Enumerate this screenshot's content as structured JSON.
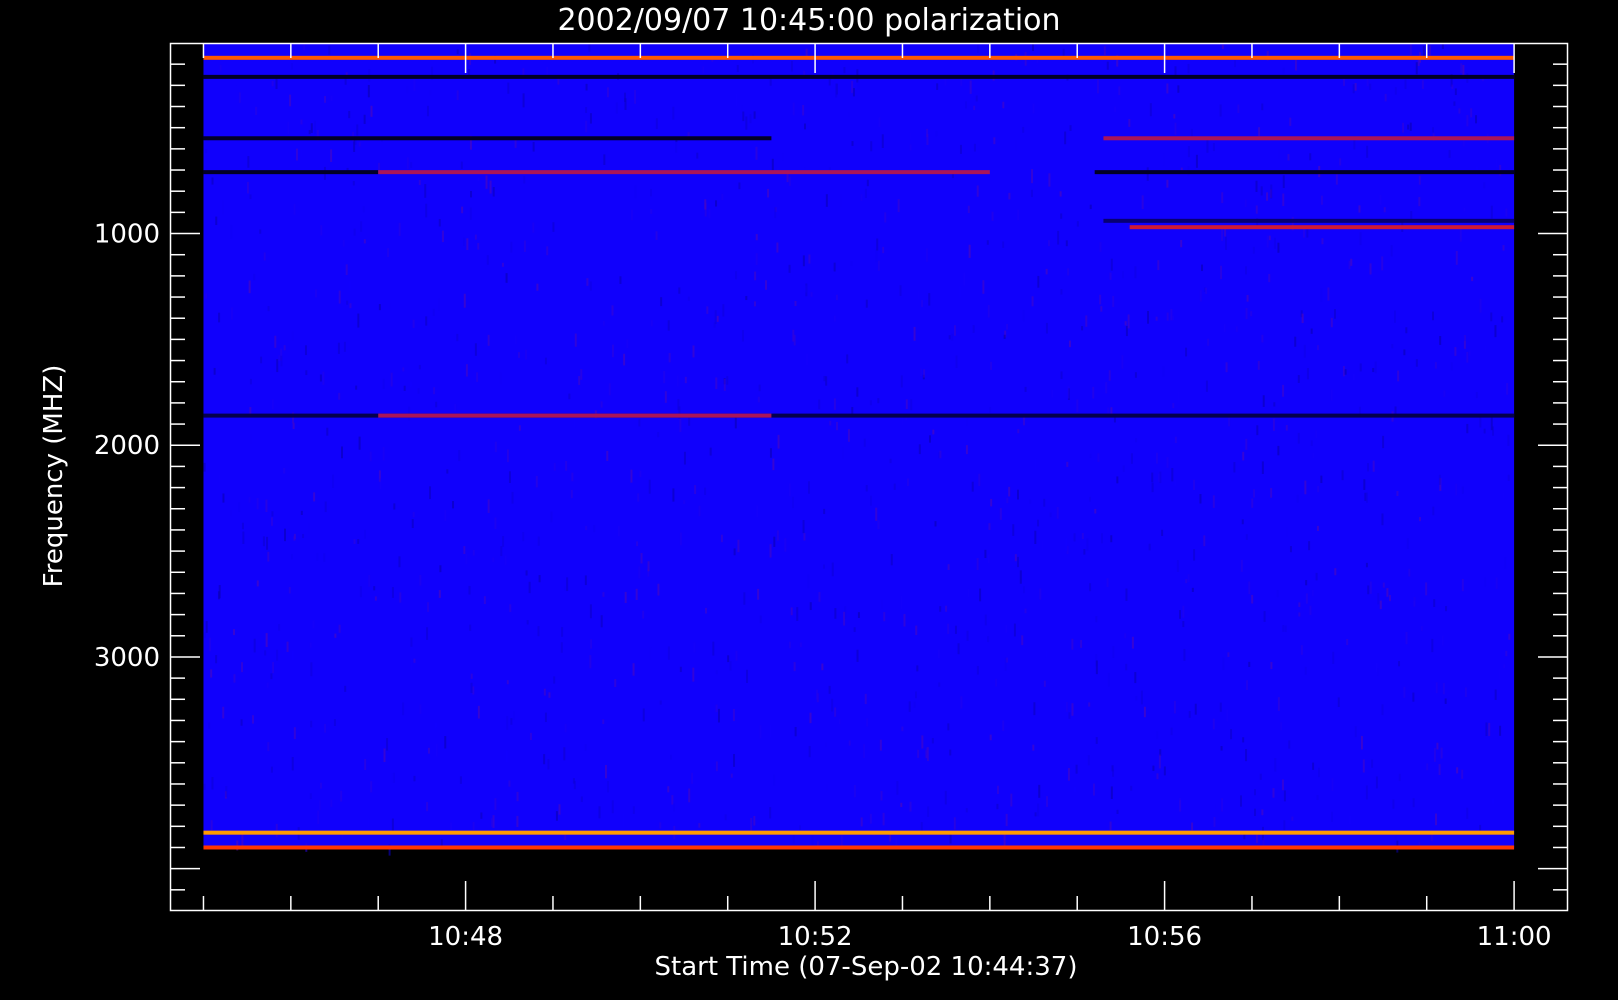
{
  "chart_data": {
    "type": "heatmap",
    "title": "2002/09/07 10:45:00 polarization",
    "xlabel": "Start Time (07-Sep-02 10:44:37)",
    "ylabel": "Frequency (MHZ)",
    "x_tick_labels": [
      "10:48",
      "10:52",
      "10:56",
      "11:00"
    ],
    "x_tick_values_min": [
      48,
      52,
      56,
      60
    ],
    "y_tick_labels": [
      "1000",
      "2000",
      "3000"
    ],
    "y_tick_values": [
      1000,
      2000,
      3000
    ],
    "xlim_min": [
      44.617,
      60.617
    ],
    "ylim": [
      4200,
      100
    ],
    "y_axis_inverted": true,
    "data_time_range_min": [
      45.0,
      60.0
    ],
    "data_freq_range_mhz": [
      100,
      3900
    ],
    "colorscale": [
      "#000000",
      "#1000ff",
      "#ff2000",
      "#ffff00"
    ],
    "background_level": 0.33,
    "features": [
      {
        "kind": "band",
        "freq_mhz": 170,
        "t_start": 45.0,
        "t_end": 60.0,
        "level": 0.75
      },
      {
        "kind": "band",
        "freq_mhz": 260,
        "t_start": 45.0,
        "t_end": 60.0,
        "level": 0.05
      },
      {
        "kind": "band",
        "freq_mhz": 550,
        "t_start": 45.0,
        "t_end": 51.5,
        "level": 0.05
      },
      {
        "kind": "band",
        "freq_mhz": 550,
        "t_start": 55.3,
        "t_end": 60.0,
        "level": 0.55
      },
      {
        "kind": "band",
        "freq_mhz": 710,
        "t_start": 45.0,
        "t_end": 47.0,
        "level": 0.05
      },
      {
        "kind": "band",
        "freq_mhz": 710,
        "t_start": 47.0,
        "t_end": 54.0,
        "level": 0.55
      },
      {
        "kind": "band",
        "freq_mhz": 710,
        "t_start": 55.2,
        "t_end": 60.0,
        "level": 0.05
      },
      {
        "kind": "band",
        "freq_mhz": 940,
        "t_start": 55.3,
        "t_end": 60.0,
        "level": 0.15
      },
      {
        "kind": "band",
        "freq_mhz": 970,
        "t_start": 55.6,
        "t_end": 60.0,
        "level": 0.6
      },
      {
        "kind": "band",
        "freq_mhz": 1860,
        "t_start": 45.0,
        "t_end": 60.0,
        "level": 0.1
      },
      {
        "kind": "band",
        "freq_mhz": 1860,
        "t_start": 47.0,
        "t_end": 51.5,
        "level": 0.55
      },
      {
        "kind": "band",
        "freq_mhz": 3830,
        "t_start": 45.0,
        "t_end": 60.0,
        "level": 0.85
      },
      {
        "kind": "band",
        "freq_mhz": 3900,
        "t_start": 45.0,
        "t_end": 60.0,
        "level": 0.7
      }
    ]
  }
}
